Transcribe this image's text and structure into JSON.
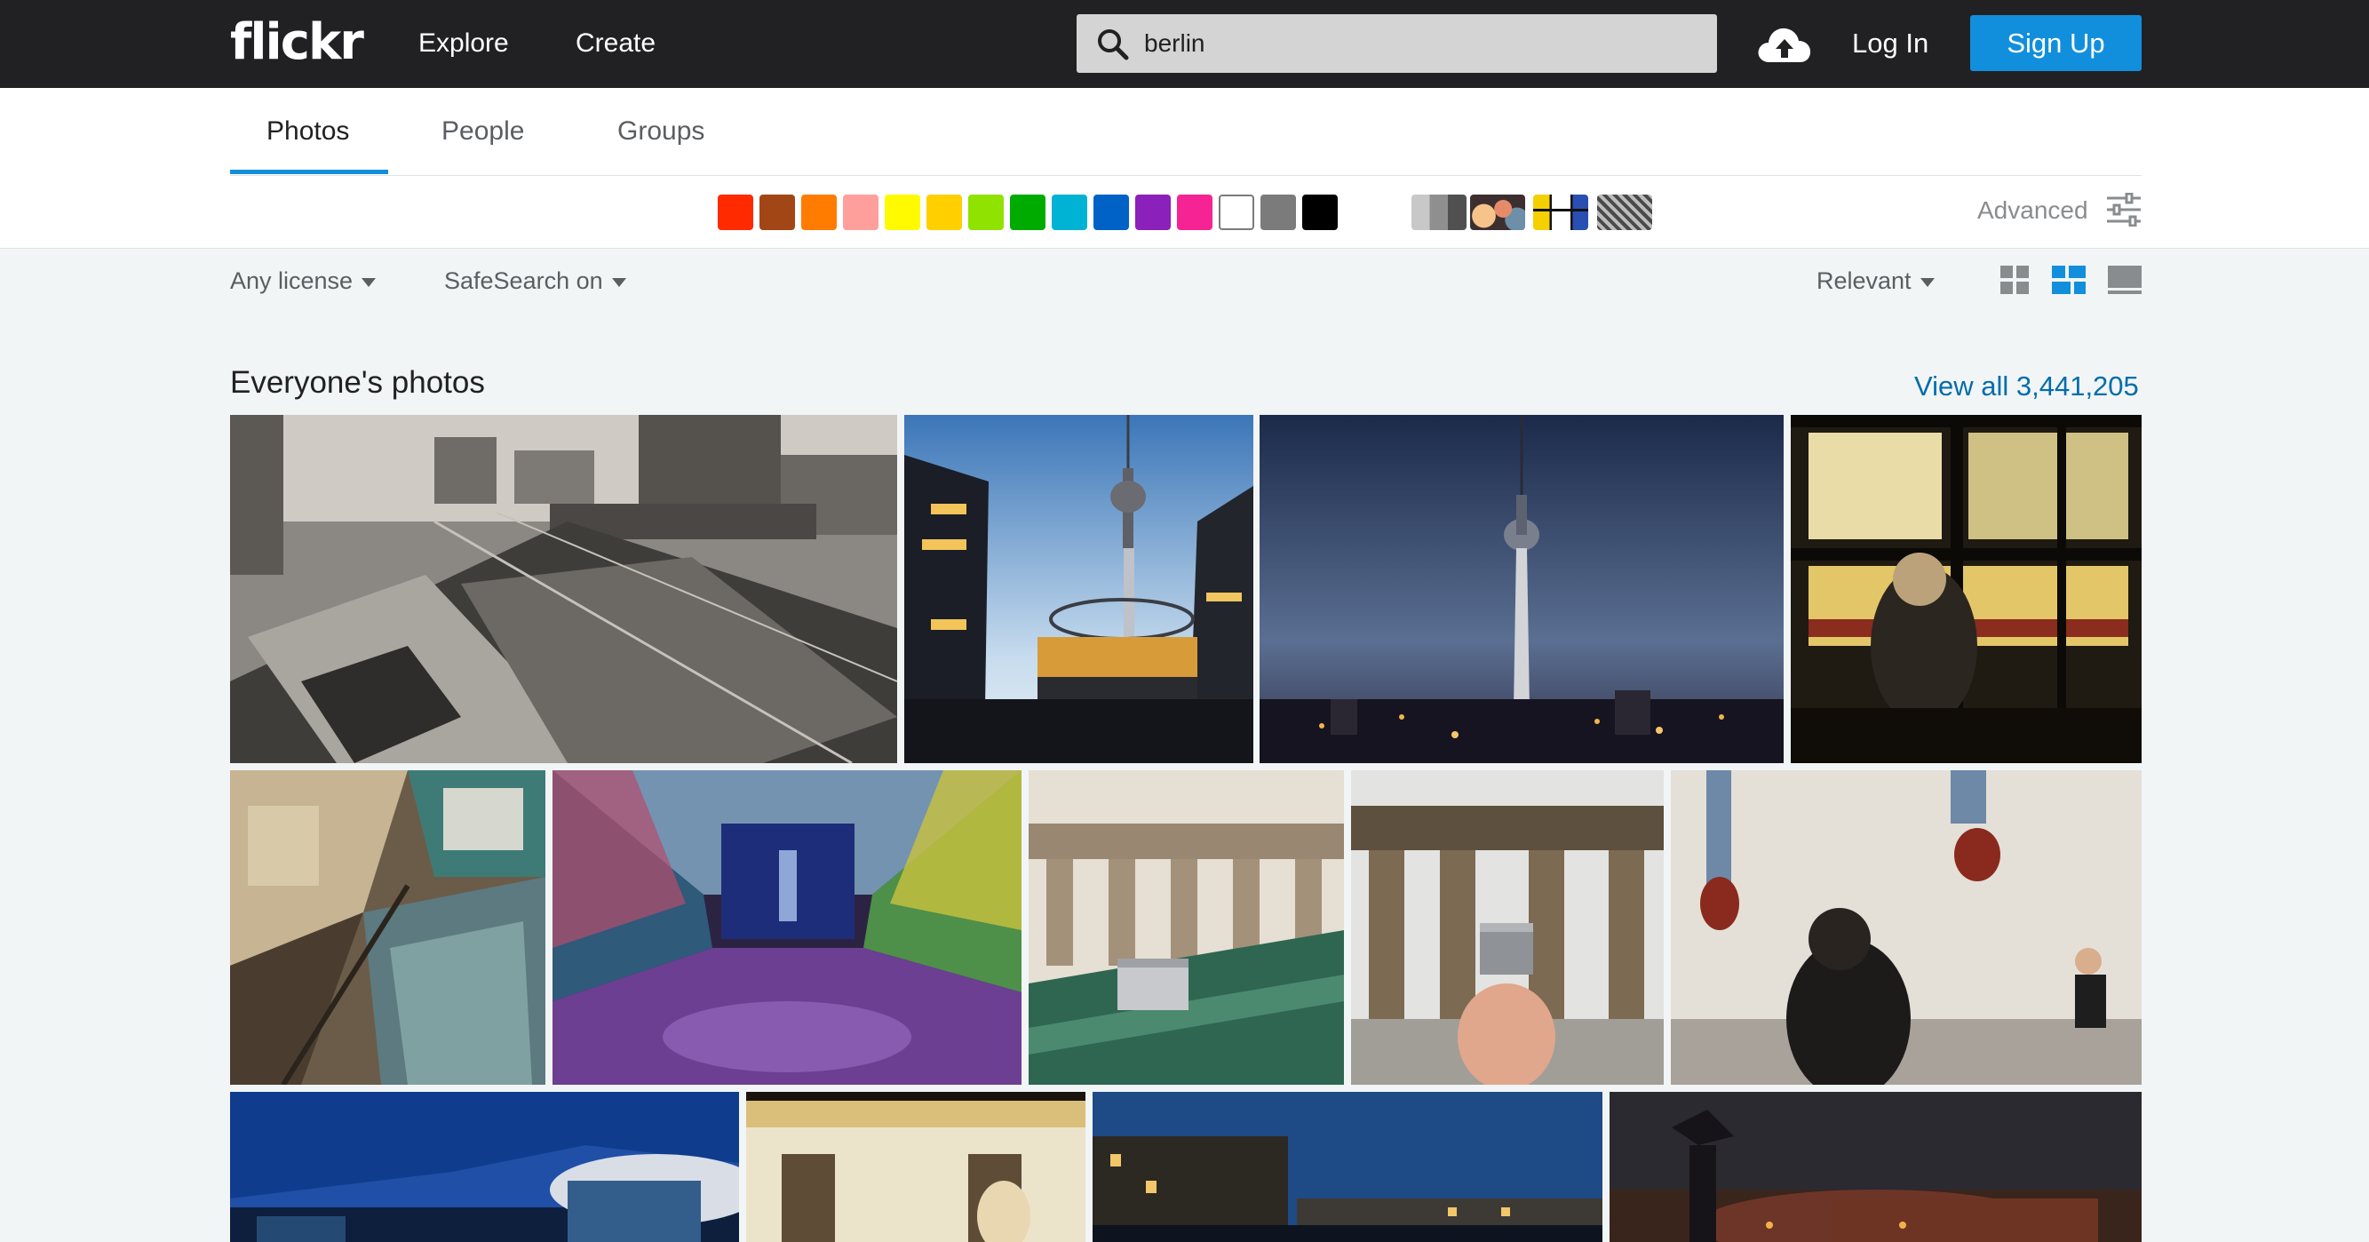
{
  "header": {
    "logo": "flickr",
    "nav": [
      "Explore",
      "Create"
    ],
    "search_value": "berlin",
    "login_label": "Log In",
    "signup_label": "Sign Up"
  },
  "tabs": [
    "Photos",
    "People",
    "Groups"
  ],
  "active_tab": "Photos",
  "color_filters": [
    "#ff2a00",
    "#a24615",
    "#ff7c00",
    "#ff9f9c",
    "#fffa00",
    "#ffcf00",
    "#90e200",
    "#00ab00",
    "#00b2d4",
    "#0062c6",
    "#8c20ba",
    "#f52394",
    "#ffffff",
    "#7b7b7b",
    "#000000"
  ],
  "style_filters": [
    "black-and-white-icon",
    "shallow-depth-of-field-icon",
    "minimalist-icon",
    "patterns-icon"
  ],
  "advanced_label": "Advanced",
  "filters": {
    "license": "Any license",
    "safesearch": "SafeSearch on",
    "sort": "Relevant"
  },
  "views": [
    "grid-view-icon",
    "justified-view-icon",
    "slideshow-view-icon"
  ],
  "section": {
    "title": "Everyone's photos",
    "view_all": "View all 3,441,205"
  },
  "photos": [
    {
      "name": "photo-alexanderplatz-street-bw"
    },
    {
      "name": "photo-tv-tower-world-clock"
    },
    {
      "name": "photo-tv-tower-dusk"
    },
    {
      "name": "photo-person-at-train-window"
    },
    {
      "name": "photo-potsdamer-platz-aerial"
    },
    {
      "name": "photo-colorful-tunnel"
    },
    {
      "name": "photo-brandenburg-gate-miniature-bench"
    },
    {
      "name": "photo-brandenburg-gate-miniature-hand"
    },
    {
      "name": "photo-red-shoes-street"
    },
    {
      "name": "photo-government-building-blue-hour"
    },
    {
      "name": "photo-sbahn-train-blur"
    },
    {
      "name": "photo-river-buildings-evening"
    },
    {
      "name": "photo-statue-palace-night"
    }
  ]
}
